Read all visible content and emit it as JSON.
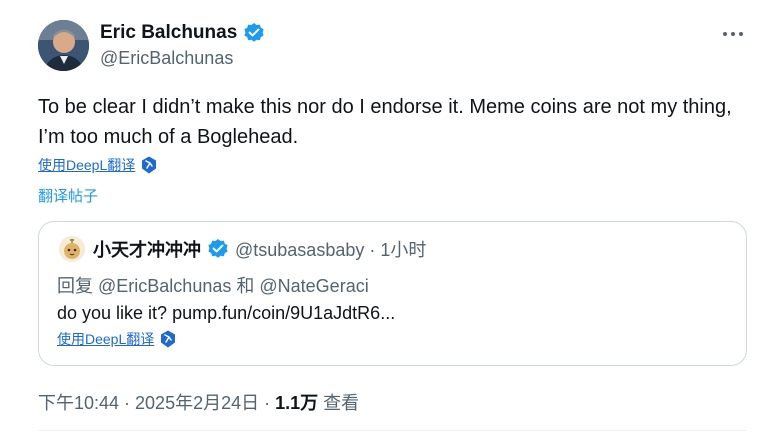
{
  "author": {
    "name": "Eric Balchunas",
    "handle": "@EricBalchunas"
  },
  "tweet": {
    "text": "To be clear I didn’t make this nor do I endorse it. Meme coins are not my thing, I’m too much of a Boglehead.",
    "deepl_label": "使用DeepL翻译",
    "translate_label": "翻译帖子"
  },
  "quote": {
    "name": "小天才冲冲冲",
    "handle_time": "@tsubasasbaby · 1小时",
    "reply_prefix": "回复",
    "reply_mention_1": "@EricBalchunas",
    "reply_conj": "和",
    "reply_mention_2": "@NateGeraci",
    "text": "do you like it?  pump.fun/coin/9U1aJdtR6...",
    "deepl_label": "使用DeepL翻译"
  },
  "meta": {
    "datetime": "下午10:44 · 2025年2月24日 · ",
    "views_count": "1.1万",
    "views_label": " 查看"
  },
  "colors": {
    "verified": "#1d9bf0",
    "deepl": "#1d6ad1",
    "secondary_text": "#536471"
  },
  "icons": {
    "more": "more-dots-icon",
    "verified": "verified-badge-icon",
    "deepl": "deepl-icon"
  }
}
